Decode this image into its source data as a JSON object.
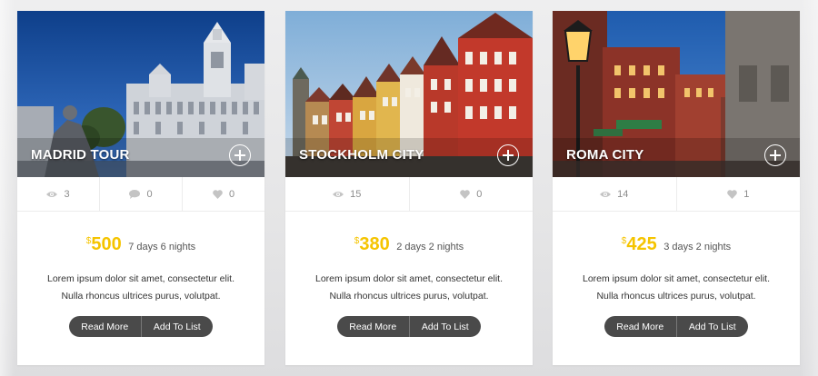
{
  "tours": [
    {
      "title": "MADRID TOUR",
      "image": "madrid-palace-photo",
      "stats": {
        "views": "3",
        "comments": "0",
        "likes": "0"
      },
      "currency": "$",
      "price": "500",
      "duration": "7 days 6 nights",
      "description_line1": "Lorem ipsum dolor sit amet, consectetur elit.",
      "description_line2": "Nulla rhoncus ultrices purus, volutpat.",
      "read_more": "Read More",
      "add_to_list": "Add To List"
    },
    {
      "title": "STOCKHOLM CITY",
      "image": "colorful-houses-photo",
      "stats": {
        "views": "15",
        "likes": "0"
      },
      "currency": "$",
      "price": "380",
      "duration": "2 days 2 nights",
      "description_line1": "Lorem ipsum dolor sit amet, consectetur elit.",
      "description_line2": "Nulla rhoncus ultrices purus, volutpat.",
      "read_more": "Read More",
      "add_to_list": "Add To List"
    },
    {
      "title": "ROMA CITY",
      "image": "street-lamp-photo",
      "stats": {
        "views": "14",
        "likes": "1"
      },
      "currency": "$",
      "price": "425",
      "duration": "3 days 2 nights",
      "description_line1": "Lorem ipsum dolor sit amet, consectetur elit.",
      "description_line2": "Nulla rhoncus ultrices purus, volutpat.",
      "read_more": "Read More",
      "add_to_list": "Add To List"
    }
  ],
  "colors": {
    "price": "#f5c400",
    "button_bg": "#4a4a4a",
    "stat_text": "#8c8c8c"
  },
  "icons": [
    "eye-icon",
    "comment-icon",
    "heart-icon",
    "plus-circle-icon"
  ]
}
